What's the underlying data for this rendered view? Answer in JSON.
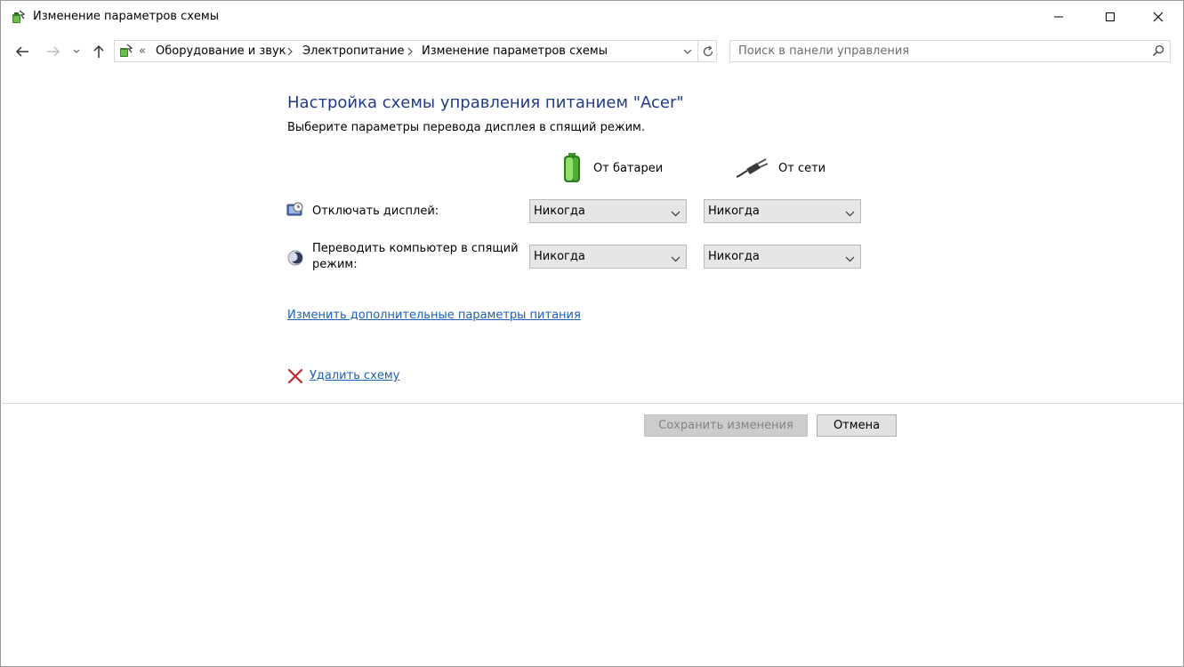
{
  "window": {
    "title": "Изменение параметров схемы"
  },
  "address": {
    "overflow": "«",
    "crumbs": [
      "Оборудование и звук",
      "Электропитание",
      "Изменение параметров схемы"
    ]
  },
  "search": {
    "placeholder": "Поиск в панели управления"
  },
  "main": {
    "heading": "Настройка схемы управления питанием \"Acer\"",
    "subheading": "Выберите параметры перевода дисплея в спящий режим.",
    "columns": {
      "battery": "От батареи",
      "plugged": "От сети"
    },
    "rows": [
      {
        "label": "Отключать дисплей:",
        "battery": "Никогда",
        "plugged": "Никогда"
      },
      {
        "label_line1": "Переводить компьютер в спящий",
        "label_line2": "режим:",
        "battery": "Никогда",
        "plugged": "Никогда"
      }
    ],
    "advanced_link": "Изменить дополнительные параметры питания",
    "delete_link": "Удалить схему"
  },
  "footer": {
    "save": "Сохранить изменения",
    "cancel": "Отмена"
  }
}
